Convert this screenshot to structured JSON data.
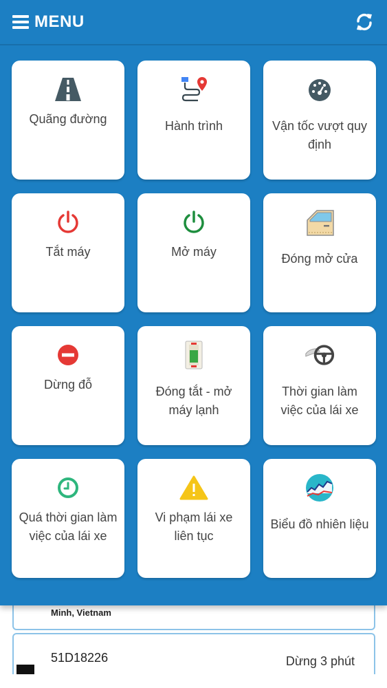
{
  "header": {
    "menu_label": "MENU",
    "icons": {
      "menu": "hamburger-icon",
      "refresh": "refresh-icon"
    },
    "background_color": "#1c7fc3"
  },
  "tiles": [
    {
      "label": "Quãng đường",
      "icon": "road-icon"
    },
    {
      "label": "Hành trình",
      "icon": "route-icon"
    },
    {
      "label": "Vận tốc vượt quy định",
      "icon": "speedometer-icon"
    },
    {
      "label": "Tắt máy",
      "icon": "power-off-icon",
      "color": "#e53935"
    },
    {
      "label": "Mở máy",
      "icon": "power-on-icon",
      "color": "#1e8e3e"
    },
    {
      "label": "Đóng mở cửa",
      "icon": "car-door-icon"
    },
    {
      "label": "Dừng đỗ",
      "icon": "stop-icon",
      "color": "#e53935"
    },
    {
      "label": "Đóng tắt - mở máy lạnh",
      "icon": "switch-icon"
    },
    {
      "label": "Thời gian làm việc của lái xe",
      "icon": "steering-wheel-icon"
    },
    {
      "label": "Quá thời gian làm việc của lái xe",
      "icon": "clock-icon",
      "color": "#2eb67d"
    },
    {
      "label": "Vi phạm lái xe liên tục",
      "icon": "warning-icon",
      "color": "#f5c518"
    },
    {
      "label": "Biểu đồ nhiên liệu",
      "icon": "fuel-chart-icon"
    }
  ],
  "vehicle_list": {
    "item1_address": "Minh, Vietnam",
    "item2_plate": "51D18226",
    "item2_status": "Dừng 3 phút"
  }
}
